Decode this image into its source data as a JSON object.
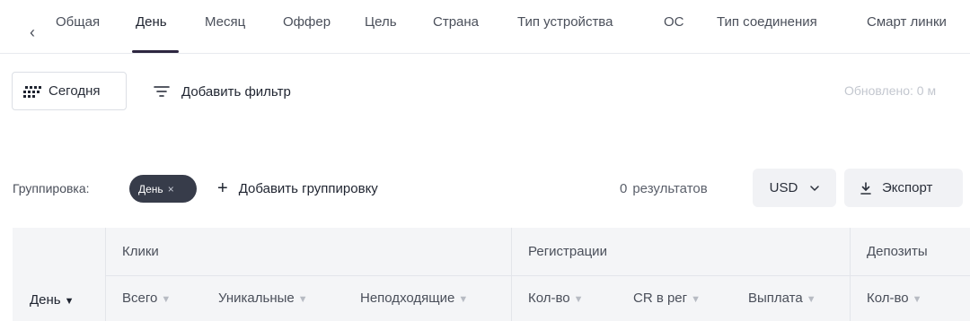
{
  "tabs": {
    "items": [
      "Общая",
      "День",
      "Месяц",
      "Оффер",
      "Цель",
      "Страна",
      "Тип устройства",
      "ОС",
      "Тип соединения",
      "Смарт линки"
    ],
    "active": "День"
  },
  "filters": {
    "date_label": "Сегодня",
    "add_filter_label": "Добавить фильтр",
    "updated_text": "Обновлено: 0 м"
  },
  "grouping": {
    "label": "Группировка:",
    "chip_label": "День",
    "chip_close": "×",
    "add_label": "Добавить группировку",
    "results_count": "0",
    "results_label": "результатов",
    "currency": "USD",
    "export_label": "Экспорт"
  },
  "table": {
    "row_header": "День",
    "groups": [
      "Клики",
      "Регистрации",
      "Депозиты"
    ],
    "columns": [
      "Всего",
      "Уникальные",
      "Неподходящие",
      "Кол-во",
      "CR в рег",
      "Выплата",
      "Кол-во"
    ]
  },
  "icons": {
    "back": "chevron-left-icon",
    "date": "grid-icon",
    "filter": "filter-lines-icon",
    "add": "plus-icon",
    "currency_dropdown": "chevron-down-icon",
    "export": "download-icon",
    "sort": "caret-down-icon"
  }
}
